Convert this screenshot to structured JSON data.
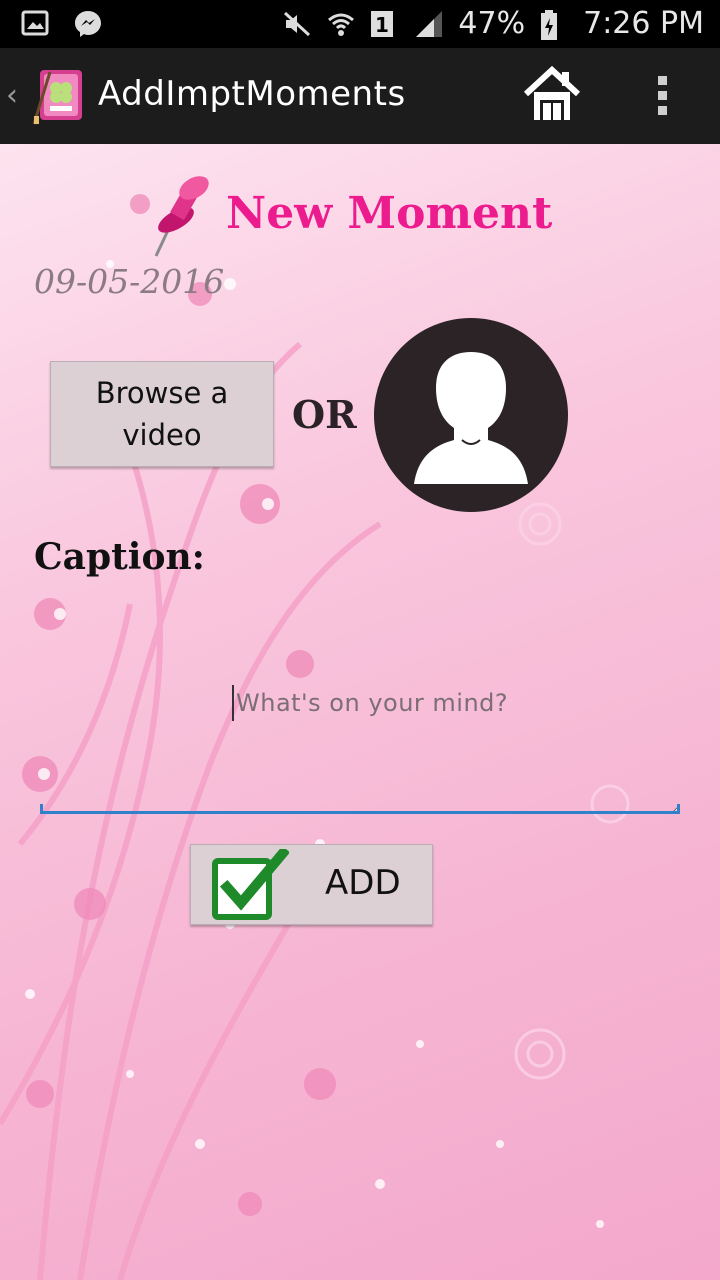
{
  "status_bar": {
    "battery": "47%",
    "time": "7:26 PM",
    "icons": [
      "gallery-icon",
      "messenger-icon",
      "mute-icon",
      "wifi-icon",
      "sim-icon",
      "signal-icon",
      "battery-icon"
    ]
  },
  "action_bar": {
    "title": "AddImptMoments",
    "icons": [
      "back-chevron-icon",
      "app-diary-icon",
      "home-icon",
      "overflow-menu-icon"
    ]
  },
  "main": {
    "title": "New Moment",
    "date": "09-05-2016",
    "browse_button_label": "Browse a video",
    "or_label": "OR",
    "caption_label": "Caption:",
    "caption_placeholder": "What's on your mind?",
    "caption_value": "",
    "add_button_label": "ADD"
  },
  "colors": {
    "title": "#ec1c8f",
    "background": "#f7c2dd",
    "underline": "#2f82c9",
    "check": "#1e8a2a"
  }
}
